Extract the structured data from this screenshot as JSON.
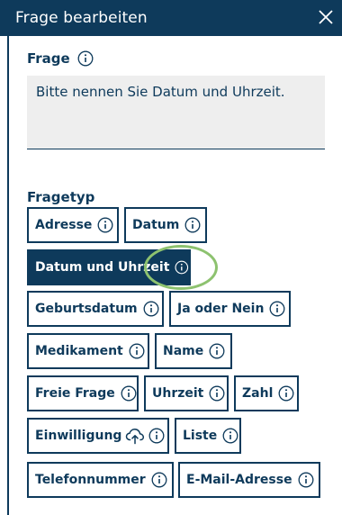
{
  "dialog": {
    "title": "Frage bearbeiten"
  },
  "question": {
    "label": "Frage",
    "value": "Bitte nennen Sie Datum und Uhrzeit."
  },
  "question_type": {
    "label": "Fragetyp",
    "options": [
      {
        "label": "Adresse",
        "selected": false
      },
      {
        "label": "Datum",
        "selected": false
      },
      {
        "label": "Datum und Uhrzeit",
        "selected": true
      },
      {
        "label": "Geburtsdatum",
        "selected": false
      },
      {
        "label": "Ja oder Nein",
        "selected": false
      },
      {
        "label": "Medikament",
        "selected": false
      },
      {
        "label": "Name",
        "selected": false
      },
      {
        "label": "Freie Frage",
        "selected": false
      },
      {
        "label": "Uhrzeit",
        "selected": false
      },
      {
        "label": "Zahl",
        "selected": false
      },
      {
        "label": "Einwilligung",
        "selected": false
      },
      {
        "label": "Liste",
        "selected": false
      },
      {
        "label": "Telefonnummer",
        "selected": false
      },
      {
        "label": "E-Mail-Adresse",
        "selected": false
      }
    ]
  },
  "colors": {
    "primary": "#0e3a5b",
    "field_bg": "#eeeeee",
    "highlight": "#8dc26f"
  }
}
